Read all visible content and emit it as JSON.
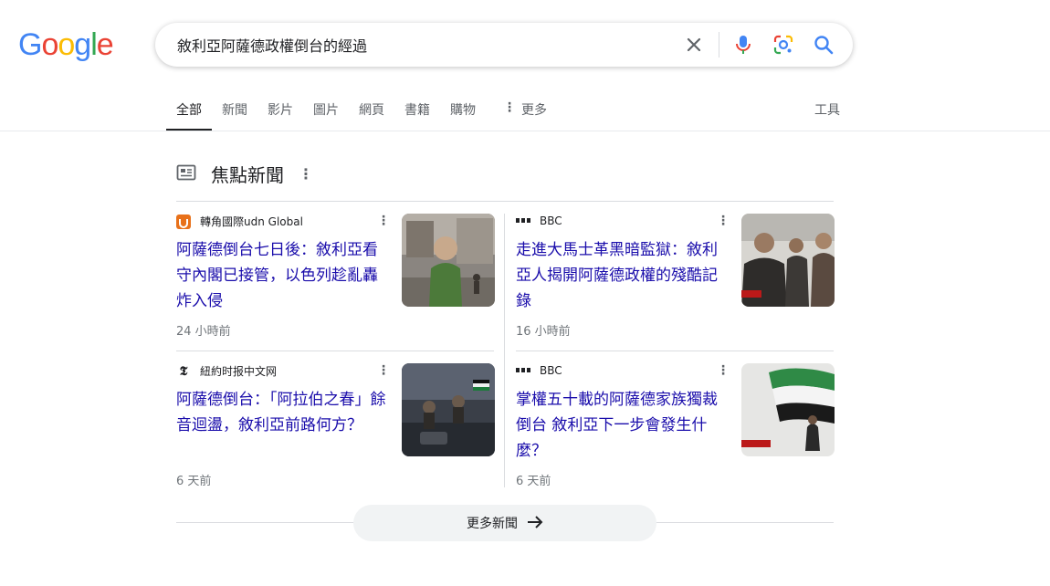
{
  "logo": {
    "letters": [
      "G",
      "o",
      "o",
      "g",
      "l",
      "e"
    ],
    "colors": [
      "#4285F4",
      "#EA4335",
      "#FBBC05",
      "#4285F4",
      "#34A853",
      "#EA4335"
    ]
  },
  "search": {
    "query": "敘利亞阿薩德政權倒台的經過"
  },
  "tabs": [
    {
      "label": "全部",
      "active": true
    },
    {
      "label": "新聞"
    },
    {
      "label": "影片"
    },
    {
      "label": "圖片"
    },
    {
      "label": "網頁"
    },
    {
      "label": "書籍"
    },
    {
      "label": "購物"
    },
    {
      "label": "更多"
    }
  ],
  "tools_label": "工具",
  "top_stories": {
    "title": "焦點新聞",
    "cards": [
      {
        "source": "轉角國際udn Global",
        "headline": "阿薩德倒台七日後：敘利亞看守內閣已接管，以色列趁亂轟炸入侵",
        "time": "24 小時前"
      },
      {
        "source": "BBC",
        "headline": "走進大馬士革黑暗監獄：敘利亞人揭開阿薩德政權的殘酷記錄",
        "time": "16 小時前"
      },
      {
        "source": "紐約时报中文网",
        "headline": "阿薩德倒台：「阿拉伯之春」餘音迴盪，敘利亞前路何方？",
        "time": "6 天前"
      },
      {
        "source": "BBC",
        "headline": "掌權五十載的阿薩德家族獨裁倒台 敘利亞下一步會發生什麼？",
        "time": "6 天前"
      }
    ],
    "more_label": "更多新聞"
  },
  "colors": {
    "link": "#1a0dab",
    "accent_udn": "#e8711a"
  }
}
